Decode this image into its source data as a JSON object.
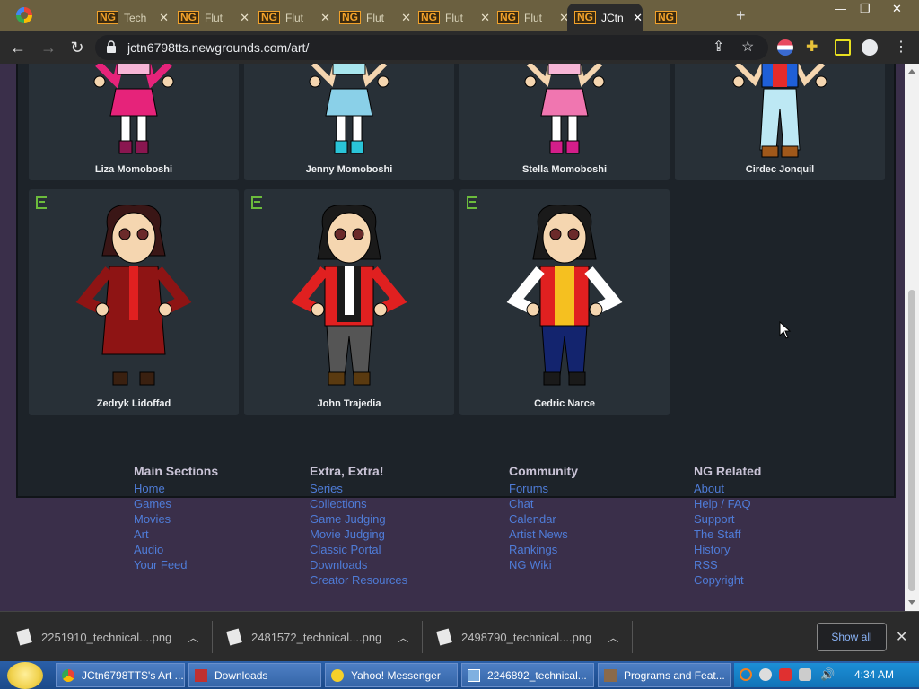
{
  "browser": {
    "tabs": [
      {
        "label": "Tech",
        "icon": "ng-logo-icon"
      },
      {
        "label": "Flut",
        "icon": "ng-logo-icon"
      },
      {
        "label": "Flut",
        "icon": "ng-logo-icon"
      },
      {
        "label": "Flut",
        "icon": "ng-logo-icon"
      },
      {
        "label": "Flut",
        "icon": "ng-logo-icon"
      },
      {
        "label": "Flut",
        "icon": "ng-logo-icon"
      },
      {
        "label": "JCtn",
        "icon": "ng-logo-icon",
        "active": true
      }
    ],
    "url": "jctn6798tts.newgrounds.com/art/"
  },
  "gallery": {
    "cards": [
      {
        "title": "Liza Momoboshi"
      },
      {
        "title": "Jenny Momoboshi"
      },
      {
        "title": "Stella Momoboshi"
      },
      {
        "title": "Cirdec Jonquil"
      },
      {
        "title": "Zedryk Lidoffad",
        "rating": "E"
      },
      {
        "title": "John Trajedia",
        "rating": "E"
      },
      {
        "title": "Cedric Narce",
        "rating": "E"
      }
    ]
  },
  "footer": {
    "columns": [
      {
        "heading": "Main Sections",
        "links": [
          "Home",
          "Games",
          "Movies",
          "Art",
          "Audio",
          "Your Feed"
        ]
      },
      {
        "heading": "Extra, Extra!",
        "links": [
          "Series",
          "Collections",
          "Game Judging",
          "Movie Judging",
          "Classic Portal",
          "Downloads",
          "Creator Resources"
        ]
      },
      {
        "heading": "Community",
        "links": [
          "Forums",
          "Chat",
          "Calendar",
          "Artist News",
          "Rankings",
          "NG Wiki"
        ]
      },
      {
        "heading": "NG Related",
        "links": [
          "About",
          "Help / FAQ",
          "Support",
          "The Staff",
          "History",
          "RSS",
          "Copyright"
        ]
      }
    ]
  },
  "downloads": {
    "items": [
      "2251910_technical....png",
      "2481572_technical....png",
      "2498790_technical....png"
    ],
    "show_all": "Show all"
  },
  "taskbar": {
    "buttons": [
      "JCtn6798TTS's Art ...",
      "Downloads",
      "Yahoo! Messenger",
      "2246892_technical...",
      "Programs and Feat..."
    ],
    "clock": "4:34 AM"
  },
  "colors": {
    "link": "#4f7cd8",
    "panel": "#1d2329",
    "card": "#283037",
    "page_bg": "#3a2f4a",
    "rating_e": "#6cbc3c"
  }
}
